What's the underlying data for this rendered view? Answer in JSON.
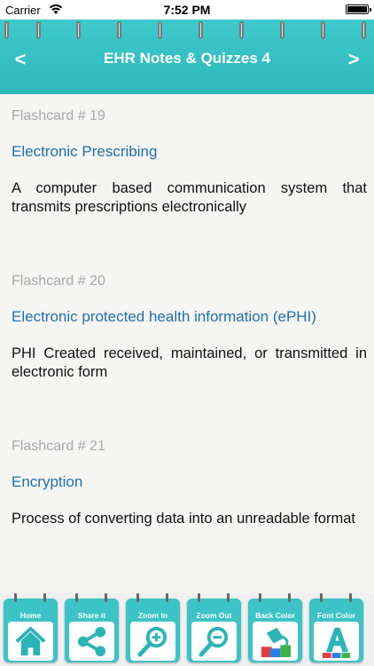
{
  "status": {
    "carrier": "Carrier",
    "time": "7:52 PM"
  },
  "header": {
    "title": "EHR Notes & Quizzes 4",
    "prev": "<",
    "next": ">"
  },
  "cards": [
    {
      "number": "Flashcard # 19",
      "term": "Electronic Prescribing",
      "definition": "A computer based communication system that transmits prescriptions electronically"
    },
    {
      "number": "Flashcard # 20",
      "term": "Electronic protected health information (ePHI)",
      "definition": "PHI Created received, maintained, or transmitted in electronic form"
    },
    {
      "number": "Flashcard # 21",
      "term": "Encryption",
      "definition": "Process of converting data into an unreadable format"
    }
  ],
  "toolbar": [
    {
      "label": "Home",
      "icon": "home-icon"
    },
    {
      "label": "Share it",
      "icon": "share-icon"
    },
    {
      "label": "Zoom In",
      "icon": "zoom-in-icon"
    },
    {
      "label": "Zoom Out",
      "icon": "zoom-out-icon"
    },
    {
      "label": "Back Color",
      "icon": "paint-bucket-icon"
    },
    {
      "label": "Font Color",
      "icon": "font-letter-icon"
    }
  ],
  "colors": {
    "accent": "#3cc3c6",
    "term": "#1f6fb0",
    "number": "#a8a8a8"
  }
}
